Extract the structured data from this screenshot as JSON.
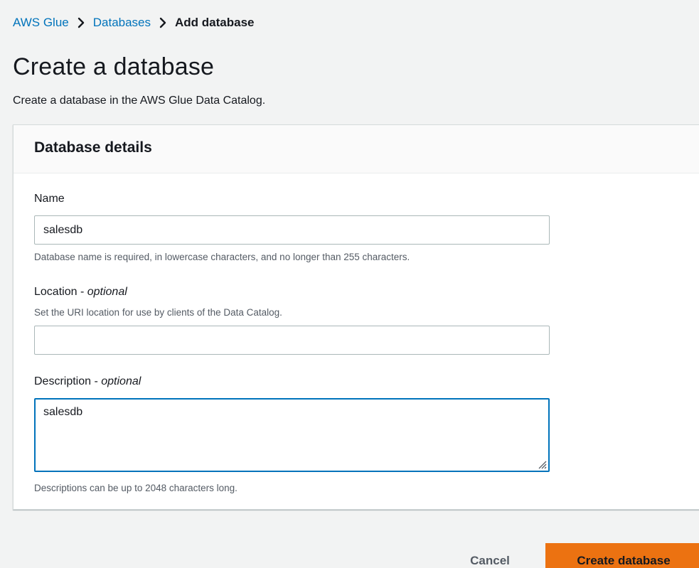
{
  "breadcrumb": {
    "items": [
      "AWS Glue",
      "Databases"
    ],
    "current": "Add database"
  },
  "header": {
    "title": "Create a database",
    "subtitle": "Create a database in the AWS Glue Data Catalog."
  },
  "panel": {
    "title": "Database details",
    "name": {
      "label": "Name",
      "value": "salesdb",
      "constraint": "Database name is required, in lowercase characters, and no longer than 255 characters."
    },
    "location": {
      "label": "Location - ",
      "label_optional": "optional",
      "description": "Set the URI location for use by clients of the Data Catalog.",
      "value": ""
    },
    "description": {
      "label": "Description - ",
      "label_optional": "optional",
      "value": "salesdb",
      "constraint": "Descriptions can be up to 2048 characters long."
    }
  },
  "actions": {
    "cancel_label": "Cancel",
    "create_label": "Create database"
  },
  "colors": {
    "link": "#0073bb",
    "primary_button": "#ec7211",
    "focus_border": "#0073bb"
  },
  "icons": [
    "chevron-right-icon",
    "resize-handle-icon"
  ]
}
